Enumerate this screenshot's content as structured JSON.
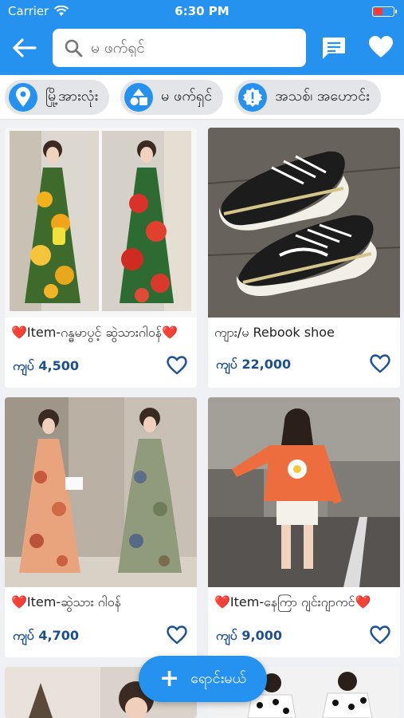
{
  "status": {
    "carrier": "Carrier",
    "time": "6:30 PM"
  },
  "header": {
    "search_placeholder": "မ ဖက်ရှင်"
  },
  "chips": [
    {
      "label": "မြို့အားလုံး",
      "icon": "location-pin-icon"
    },
    {
      "label": "မ ဖက်ရှင်",
      "icon": "category-shapes-icon"
    },
    {
      "label": "အသစ်၊ အဟောင်း",
      "icon": "alert-badge-icon"
    }
  ],
  "products": [
    {
      "title": "❤️Item-ဂန္ဓမာပွင့် ဆွဲသားဂါဝန်❤️",
      "price": "ကျပ် 4,500",
      "image": "floral-dress-photo"
    },
    {
      "title": "ကျား/မ Rebook shoe",
      "price": "ကျပ် 22,000",
      "image": "sneakers-photo"
    },
    {
      "title": "❤️Item-ဆွဲသား ဂါဝန်",
      "price": "ကျပ် 4,700",
      "image": "paisley-dress-photo"
    },
    {
      "title": "❤️Item-နေကြာ ဂျင်းဂျာကင်❤️",
      "price": "ကျပ် 9,000",
      "image": "orange-jacket-photo"
    }
  ],
  "fab": {
    "label": "ရောင်းမယ်"
  },
  "colors": {
    "primary": "#2592f0",
    "price": "#1d4f8f",
    "heart": "#1a4f9c"
  }
}
